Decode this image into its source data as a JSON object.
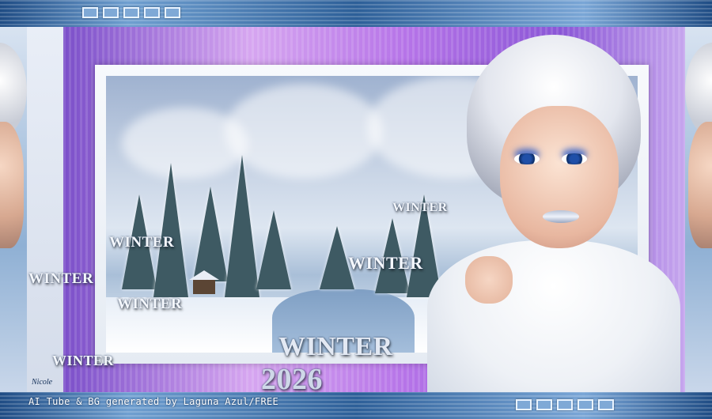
{
  "labels": {
    "winter_a": "WINTER",
    "winter_b": "WINTER",
    "winter_c": "WINTER",
    "winter_d": "WINTER",
    "winter_e": "WINTER",
    "winter_f": "WINTER",
    "winter_main": "WINTER",
    "year": "2026"
  },
  "signature": "Nicole",
  "credit": "AI Tube & BG generated by Laguna Azul/FREE",
  "colors": {
    "frame_blue": "#2f5f95",
    "purple_band": "#b674e8",
    "text_white": "#f4f7fc"
  },
  "decorations": {
    "top_boxes": 5,
    "bottom_boxes": 5
  }
}
